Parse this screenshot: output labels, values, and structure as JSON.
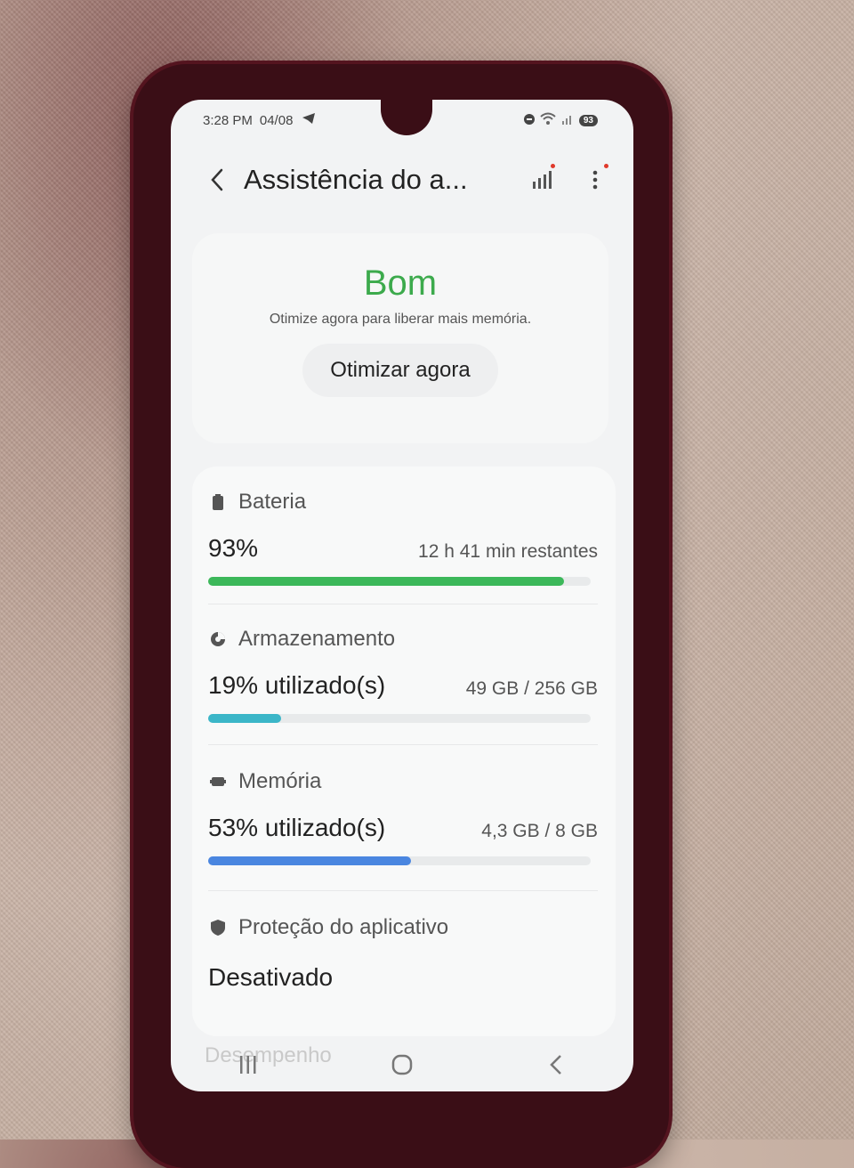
{
  "status_bar": {
    "time": "3:28 PM",
    "date": "04/08",
    "battery": "93"
  },
  "app_bar": {
    "title": "Assistência do a..."
  },
  "status_card": {
    "status": "Bom",
    "subtitle": "Otimize agora para liberar mais memória.",
    "button": "Otimizar agora"
  },
  "battery": {
    "label": "Bateria",
    "value": "93%",
    "detail": "12 h 41 min restantes",
    "level": 0.93,
    "color": "#3cb85a"
  },
  "storage": {
    "label": "Armazenamento",
    "value": "19% utilizado(s)",
    "detail": "49 GB / 256 GB",
    "level": 0.19,
    "color": "#3bb6c8"
  },
  "memory": {
    "label": "Memória",
    "value": "53% utilizado(s)",
    "detail": "4,3 GB / 8 GB",
    "level": 0.53,
    "color": "#4a86e0"
  },
  "app_protection": {
    "label": "Proteção do aplicativo",
    "value": "Desativado"
  },
  "next_section": {
    "label": "Desempenho"
  },
  "icons": [
    "back-icon",
    "signal-chart-icon",
    "more-vert-icon",
    "battery-icon",
    "storage-icon",
    "memory-icon",
    "shield-icon",
    "recents-icon",
    "home-icon",
    "nav-back-icon"
  ]
}
